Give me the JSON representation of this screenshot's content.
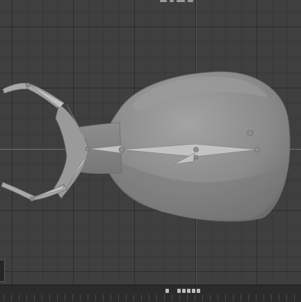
{
  "viewport": {
    "name": "3d-viewport",
    "background": "#3f3f3f",
    "grid_color": "#2e2e2e",
    "x_axis_color": "#8a8a3a",
    "mesh_color": "#8c8c8c",
    "bone_color": "#b5b5b5"
  },
  "timeline": {
    "transport_icons": [
      "jump-start-icon",
      "prev-keyframe-icon",
      "play-reverse-icon",
      "play-icon",
      "next-keyframe-icon",
      "jump-end-icon"
    ],
    "frame_marks": [
      "",
      "",
      "",
      "",
      "",
      "",
      "",
      "",
      "",
      "",
      "",
      "",
      "",
      "",
      "",
      "",
      "",
      "",
      "",
      "",
      "",
      "",
      "",
      "",
      "",
      "",
      "",
      "",
      "",
      "",
      "",
      "",
      "",
      "",
      "",
      "",
      "",
      ""
    ]
  }
}
